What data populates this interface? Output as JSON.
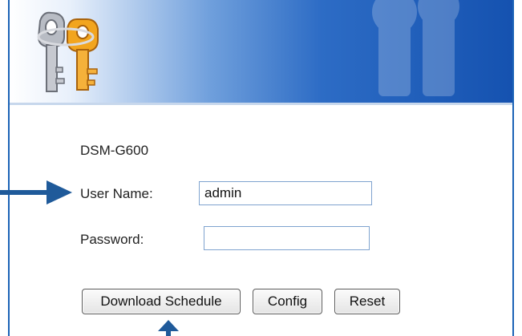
{
  "device": {
    "model": "DSM-G600"
  },
  "icons": {
    "logo": "keys-logo-icon",
    "arrow_right": "arrow-right-icon",
    "arrow_up": "arrow-up-icon"
  },
  "colors": {
    "banner_dark": "#1552b0",
    "frame_border": "#1c63b6",
    "arrow": "#1f5a9a",
    "key_gold": "#f0a020",
    "key_silver": "#b8bcc4"
  },
  "login": {
    "username_label": "User Name:",
    "username_value": "admin",
    "password_label": "Password:",
    "password_value": ""
  },
  "buttons": {
    "download_schedule": "Download Schedule",
    "config": "Config",
    "reset": "Reset"
  }
}
